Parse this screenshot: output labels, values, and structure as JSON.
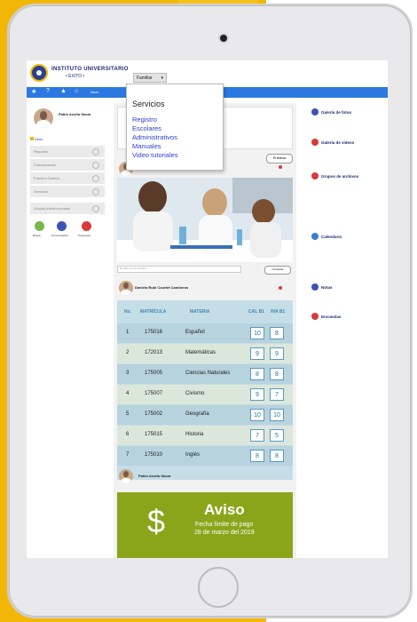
{
  "header": {
    "logo_line1": "INSTITUTO UNIVERSITARIO",
    "logo_line2": "• ÉXITO •",
    "familiar_button": "Familiar"
  },
  "navbar": {
    "breadcrumb": "Inicio"
  },
  "user": {
    "name": "Pablo Acuña Garza"
  },
  "left_menu": {
    "items": [
      "Inicio",
      "Reportes",
      "Comunicación",
      "Práctica Galería",
      "Servicios",
      "Grupos Instruccionales"
    ],
    "apps": [
      "Boleta",
      "Comunicación",
      "Propuesta"
    ]
  },
  "center": {
    "publish_button": "Publicar",
    "comment_placeholder": "Escribe un comentario...",
    "comment_button": "Comentar",
    "post_author": "Daniela Rubí Courtet Camberos",
    "table_headers": [
      "No.",
      "MATRÍCULA",
      "MATERIA",
      "CAL B1",
      "INA B1"
    ],
    "table_rows": [
      {
        "no": "1",
        "matricula": "175016",
        "materia": "Español",
        "cal": "10",
        "ina": "8"
      },
      {
        "no": "2",
        "matricula": "172013",
        "materia": "Matemáticas",
        "cal": "9",
        "ina": "9"
      },
      {
        "no": "3",
        "matricula": "175005",
        "materia": "Ciencias Naturales",
        "cal": "8",
        "ina": "8"
      },
      {
        "no": "4",
        "matricula": "175007",
        "materia": "Civismo",
        "cal": "9",
        "ina": "7"
      },
      {
        "no": "5",
        "matricula": "175002",
        "materia": "Geografía",
        "cal": "10",
        "ina": "10"
      },
      {
        "no": "6",
        "matricula": "175015",
        "materia": "Historia",
        "cal": "7",
        "ina": "5"
      },
      {
        "no": "7",
        "matricula": "175010",
        "materia": "Inglés",
        "cal": "8",
        "ina": "8"
      }
    ],
    "second_author": "Pablo Acuña Garza",
    "aviso": {
      "symbol": "$",
      "title": "Aviso",
      "line1": "Fecha límite de pago",
      "line2": "28 de marzo del 2019"
    }
  },
  "right_panel": {
    "items": [
      "Galería de fotos",
      "Galería de videos",
      "Grupos de archivos",
      "Calendario",
      "Notas",
      "Encuestas"
    ]
  },
  "dropdown": {
    "title": "Servicios",
    "items": [
      "Registro",
      "Escolares",
      "Administrativos",
      "Manuales",
      "Video tutoriales"
    ]
  },
  "colors": {
    "brand_yellow": "#f2b705",
    "navbar_blue": "#2b79e0",
    "aviso_green": "#8aa51a",
    "grade_blue": "#3f88b5"
  }
}
